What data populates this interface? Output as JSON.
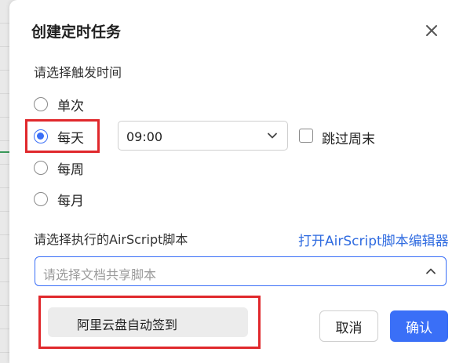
{
  "dialog": {
    "title": "创建定时任务",
    "close_icon": "close-icon"
  },
  "trigger": {
    "label": "请选择触发时间",
    "options": [
      {
        "label": "单次",
        "checked": false
      },
      {
        "label": "每天",
        "checked": true
      },
      {
        "label": "每周",
        "checked": false
      },
      {
        "label": "每月",
        "checked": false
      }
    ],
    "time_value": "09:00",
    "skip_weekend_label": "跳过周末",
    "skip_weekend_checked": false
  },
  "script": {
    "label": "请选择执行的AirScript脚本",
    "open_editor_link": "打开AirScript脚本编辑器",
    "placeholder": "请选择文档共享脚本",
    "dropdown_items": [
      "阿里云盘自动签到"
    ]
  },
  "buttons": {
    "cancel": "取消",
    "confirm": "确认"
  },
  "colors": {
    "accent": "#3a6ff7",
    "highlight": "#e0282c",
    "link": "#2f6be0"
  }
}
